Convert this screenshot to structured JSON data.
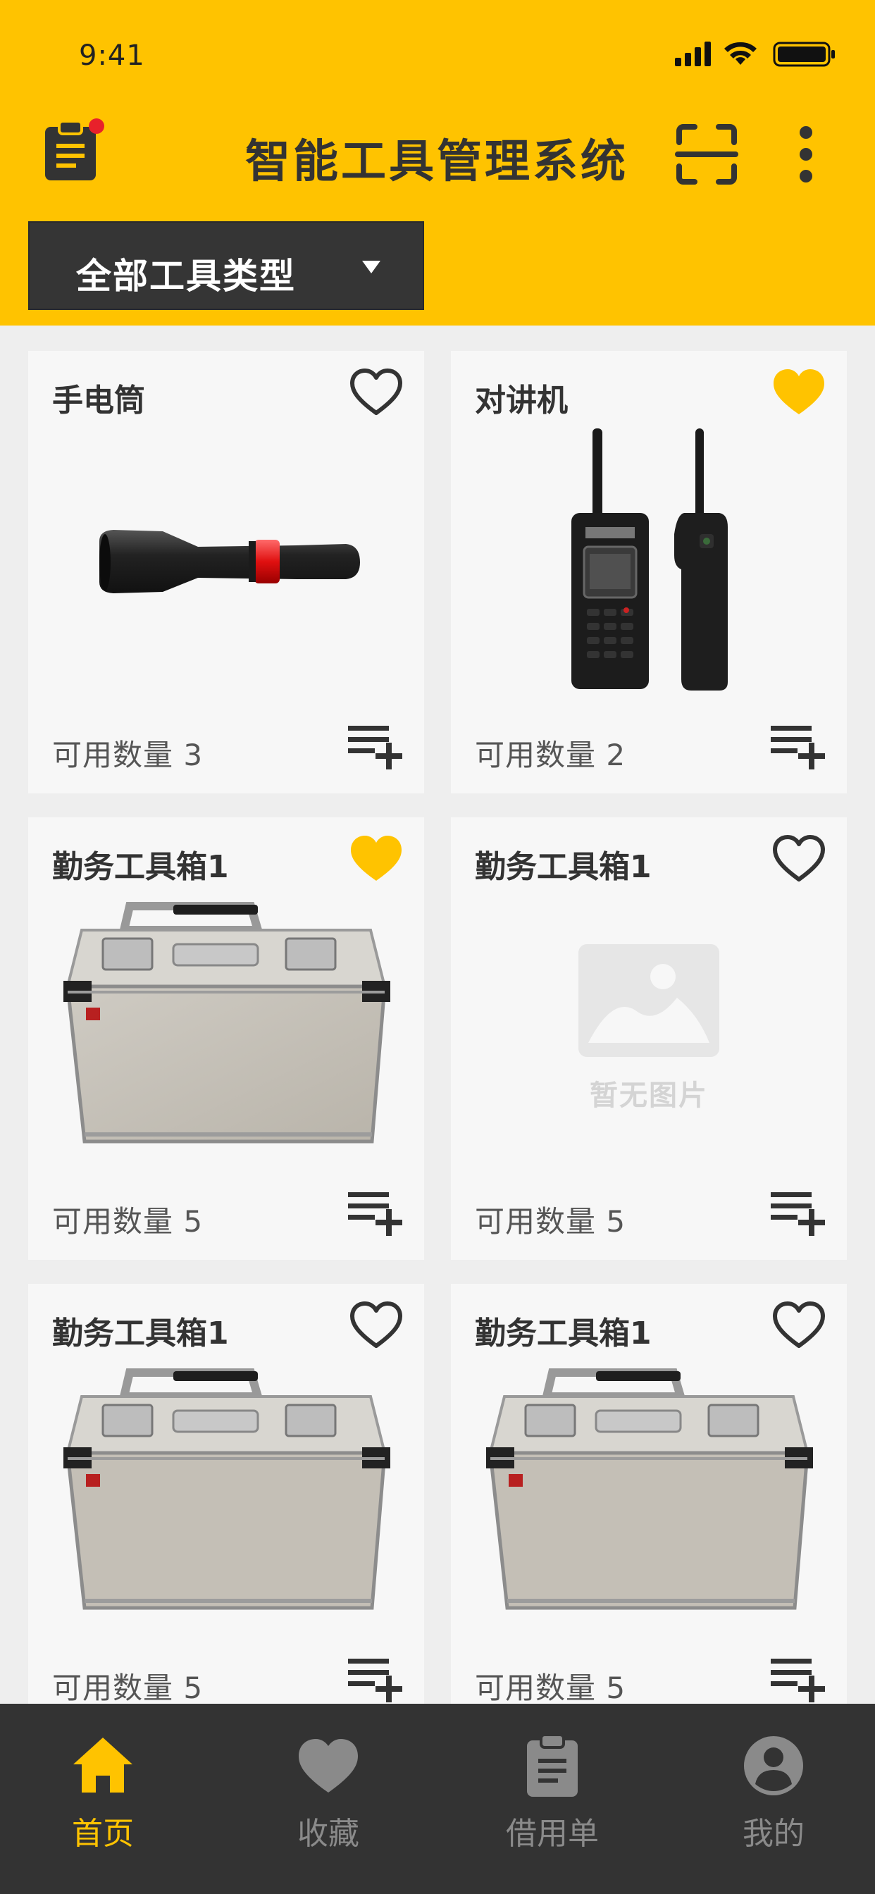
{
  "status_bar": {
    "time": "9:41"
  },
  "header": {
    "title": "智能工具管理系统",
    "filter": {
      "selected": "全部工具类型"
    }
  },
  "colors": {
    "accent": "#ffc300",
    "dark": "#333333",
    "badge": "#e8212b"
  },
  "tools": [
    {
      "name": "手电筒",
      "quantity_text": "可用数量 3",
      "favorited": false,
      "image": "flashlight"
    },
    {
      "name": "对讲机",
      "quantity_text": "可用数量 2",
      "favorited": true,
      "image": "walkie-talkie"
    },
    {
      "name": "勤务工具箱1",
      "quantity_text": "可用数量 5",
      "favorited": true,
      "image": "toolbox"
    },
    {
      "name": "勤务工具箱1",
      "quantity_text": "可用数量 5",
      "favorited": false,
      "image": "none"
    },
    {
      "name": "勤务工具箱1",
      "quantity_text": "可用数量 5",
      "favorited": false,
      "image": "toolbox"
    },
    {
      "name": "勤务工具箱1",
      "quantity_text": "可用数量 5",
      "favorited": false,
      "image": "toolbox"
    }
  ],
  "no_image_text": "暂无图片",
  "tabbar": {
    "items": [
      {
        "label": "首页",
        "icon": "home-icon",
        "active": true
      },
      {
        "label": "收藏",
        "icon": "heart-icon",
        "active": false
      },
      {
        "label": "借用单",
        "icon": "clipboard-icon",
        "active": false
      },
      {
        "label": "我的",
        "icon": "user-icon",
        "active": false
      }
    ]
  }
}
